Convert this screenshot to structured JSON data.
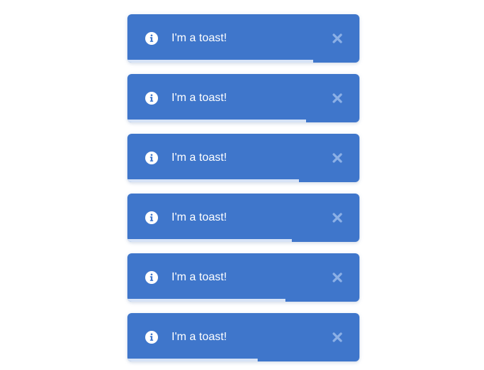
{
  "colors": {
    "page_background": "#ffffff",
    "toast_background": "#3f76cb",
    "toast_text": "#ffffff",
    "close_icon": "#8cb0e6",
    "progress_bar": "#d7e3f6"
  },
  "toasts": [
    {
      "message": "I'm a toast!",
      "icon": "info-circle-icon",
      "close_icon": "close-icon",
      "progress": 0.8
    },
    {
      "message": "I'm a toast!",
      "icon": "info-circle-icon",
      "close_icon": "close-icon",
      "progress": 0.77
    },
    {
      "message": "I'm a toast!",
      "icon": "info-circle-icon",
      "close_icon": "close-icon",
      "progress": 0.74
    },
    {
      "message": "I'm a toast!",
      "icon": "info-circle-icon",
      "close_icon": "close-icon",
      "progress": 0.71
    },
    {
      "message": "I'm a toast!",
      "icon": "info-circle-icon",
      "close_icon": "close-icon",
      "progress": 0.68
    },
    {
      "message": "I'm a toast!",
      "icon": "info-circle-icon",
      "close_icon": "close-icon",
      "progress": 0.56
    }
  ]
}
